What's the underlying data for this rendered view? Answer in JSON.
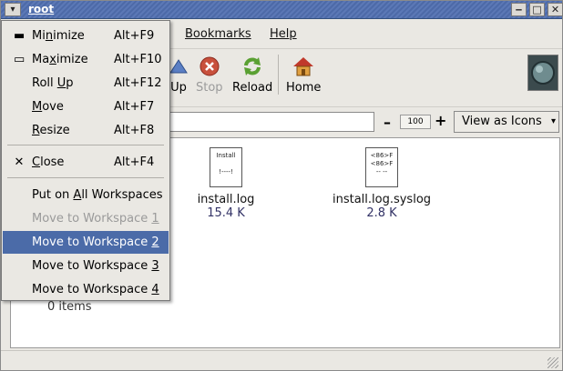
{
  "window": {
    "title": "root",
    "minimize_glyph": "‒",
    "maximize_glyph": "□",
    "close_glyph": "✕"
  },
  "menubar": {
    "items": [
      {
        "label": "Bookmarks"
      },
      {
        "label": "Help"
      }
    ]
  },
  "toolbar": {
    "buttons": [
      {
        "label": "Up",
        "icon": "up-arrow-icon"
      },
      {
        "label": "Stop",
        "icon": "stop-icon",
        "disabled": true
      },
      {
        "label": "Reload",
        "icon": "reload-icon"
      },
      {
        "label": "Home",
        "icon": "home-icon"
      }
    ]
  },
  "locationbar": {
    "location_value": "",
    "zoom_minus": "–",
    "zoom_level": "100",
    "zoom_plus": "+",
    "view_as": "View as Icons"
  },
  "files": [
    {
      "name": "install.log",
      "size": "15.4 K",
      "icon_text": "Install\n\n!----!"
    },
    {
      "name": "install.log.syslog",
      "size": "2.8 K",
      "icon_text": "<86>F\n<86>F\n-- --"
    }
  ],
  "status": {
    "items_count": "0 items"
  },
  "window_menu": {
    "items": [
      {
        "label": "Minimize",
        "underline_char": "n",
        "accel": "Alt+F9",
        "icon": "minimize-icon"
      },
      {
        "label": "Maximize",
        "underline_char": "x",
        "accel": "Alt+F10",
        "icon": "maximize-icon"
      },
      {
        "label": "Roll Up",
        "underline_char": "U",
        "accel": "Alt+F12"
      },
      {
        "label": "Move",
        "underline_char": "M",
        "accel": "Alt+F7"
      },
      {
        "label": "Resize",
        "underline_char": "R",
        "accel": "Alt+F8"
      },
      {
        "label": "Close",
        "underline_char": "C",
        "accel": "Alt+F4",
        "icon": "close-icon"
      },
      {
        "label": "Put on All Workspaces",
        "underline_char": "A",
        "accel": ""
      },
      {
        "label": "Move to Workspace 1",
        "underline_char": "1",
        "accel": "",
        "disabled": true
      },
      {
        "label": "Move to Workspace 2",
        "underline_char": "2",
        "accel": "",
        "active": true
      },
      {
        "label": "Move to Workspace 3",
        "underline_char": "3",
        "accel": ""
      },
      {
        "label": "Move to Workspace 4",
        "underline_char": "4",
        "accel": ""
      }
    ]
  },
  "colors": {
    "titlebar": "#4d6aa8",
    "menu_highlight": "#4b6ba8",
    "stop_red": "#c8503c",
    "reload_green": "#5aa032",
    "home_roof": "#c0392b"
  }
}
